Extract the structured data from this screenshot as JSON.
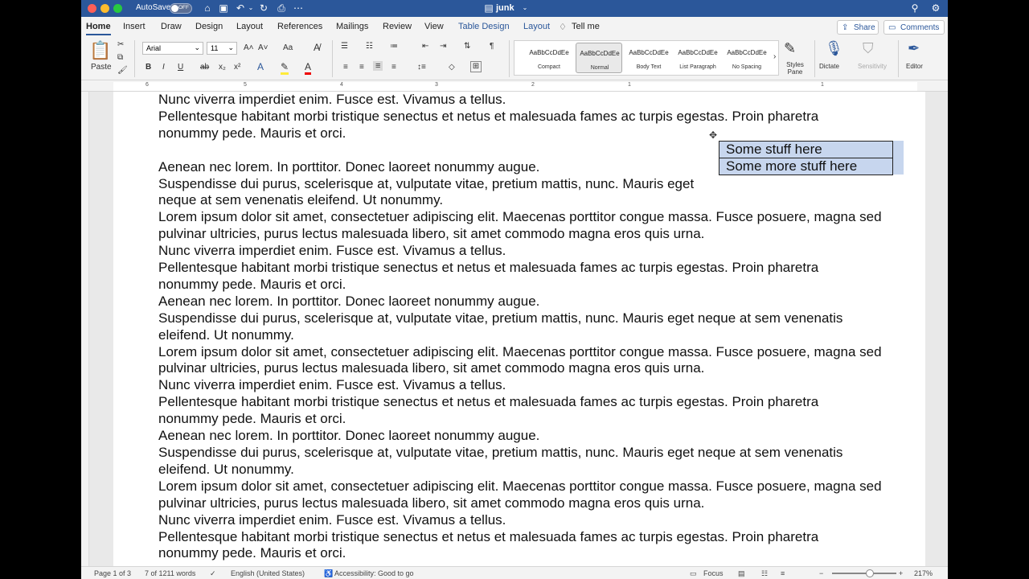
{
  "titlebar": {
    "autosave_label": "AutoSave",
    "autosave_state": "OFF",
    "doc_title": "junk"
  },
  "tabs": [
    "Home",
    "Insert",
    "Draw",
    "Design",
    "Layout",
    "References",
    "Mailings",
    "Review",
    "View",
    "Table Design",
    "Layout"
  ],
  "tell_me": "Tell me",
  "share_label": "Share",
  "comments_label": "Comments",
  "ribbon": {
    "paste_label": "Paste",
    "font_name": "Arial",
    "font_size": "11",
    "styles": [
      {
        "sample": "AaBbCcDdEe",
        "name": "Compact"
      },
      {
        "sample": "AaBbCcDdEe",
        "name": "Normal"
      },
      {
        "sample": "AaBbCcDdEe",
        "name": "Body Text"
      },
      {
        "sample": "AaBbCcDdEe",
        "name": "List Paragraph"
      },
      {
        "sample": "AaBbCcDdEe",
        "name": "No Spacing"
      }
    ],
    "styles_pane_label": "Styles Pane",
    "dictate_label": "Dictate",
    "sensitivity_label": "Sensitivity",
    "editor_label": "Editor"
  },
  "ruler_numbers": [
    "6",
    "5",
    "4",
    "3",
    "2",
    "1",
    "1"
  ],
  "document": {
    "paragraphs": [
      "Nunc viverra imperdiet enim. Fusce est. Vivamus a tellus.",
      "Pellentesque habitant morbi tristique senectus et netus et malesuada fames ac turpis egestas. Proin pharetra nonummy pede. Mauris et orci.",
      "",
      "Aenean nec lorem. In porttitor. Donec laoreet nonummy augue.",
      "Suspendisse dui purus, scelerisque at, vulputate vitae, pretium mattis, nunc. Mauris eget neque at sem venenatis eleifend. Ut nonummy.",
      "Lorem ipsum dolor sit amet, consectetuer adipiscing elit. Maecenas porttitor congue massa. Fusce posuere, magna sed pulvinar ultricies, purus lectus malesuada libero, sit amet commodo magna eros quis urna.",
      "Nunc viverra imperdiet enim. Fusce est. Vivamus a tellus.",
      "Pellentesque habitant morbi tristique senectus et netus et malesuada fames ac turpis egestas. Proin pharetra nonummy pede. Mauris et orci.",
      "Aenean nec lorem. In porttitor. Donec laoreet nonummy augue.",
      "Suspendisse dui purus, scelerisque at, vulputate vitae, pretium mattis, nunc. Mauris eget neque at sem venenatis eleifend. Ut nonummy.",
      "Lorem ipsum dolor sit amet, consectetuer adipiscing elit. Maecenas porttitor congue massa. Fusce posuere, magna sed pulvinar ultricies, purus lectus malesuada libero, sit amet commodo magna eros quis urna.",
      "Nunc viverra imperdiet enim. Fusce est. Vivamus a tellus.",
      "Pellentesque habitant morbi tristique senectus et netus et malesuada fames ac turpis egestas. Proin pharetra nonummy pede. Mauris et orci.",
      "Aenean nec lorem. In porttitor. Donec laoreet nonummy augue.",
      "Suspendisse dui purus, scelerisque at, vulputate vitae, pretium mattis, nunc. Mauris eget neque at sem venenatis eleifend. Ut nonummy.",
      "Lorem ipsum dolor sit amet, consectetuer adipiscing elit. Maecenas porttitor congue massa. Fusce posuere, magna sed pulvinar ultricies, purus lectus malesuada libero, sit amet commodo magna eros quis urna.",
      "Nunc viverra imperdiet enim. Fusce est. Vivamus a tellus.",
      "Pellentesque habitant morbi tristique senectus et netus et malesuada fames ac turpis egestas. Proin pharetra nonummy pede. Mauris et orci."
    ],
    "table_rows": [
      "Some stuff here",
      "Some more stuff here"
    ]
  },
  "statusbar": {
    "page": "Page 1 of 3",
    "words": "7 of 1211 words",
    "language": "English (United States)",
    "accessibility": "Accessibility: Good to go",
    "focus": "Focus",
    "zoom": "217%"
  },
  "colors": {
    "brand": "#2b579a",
    "table_fill": "#c7d6ee"
  }
}
